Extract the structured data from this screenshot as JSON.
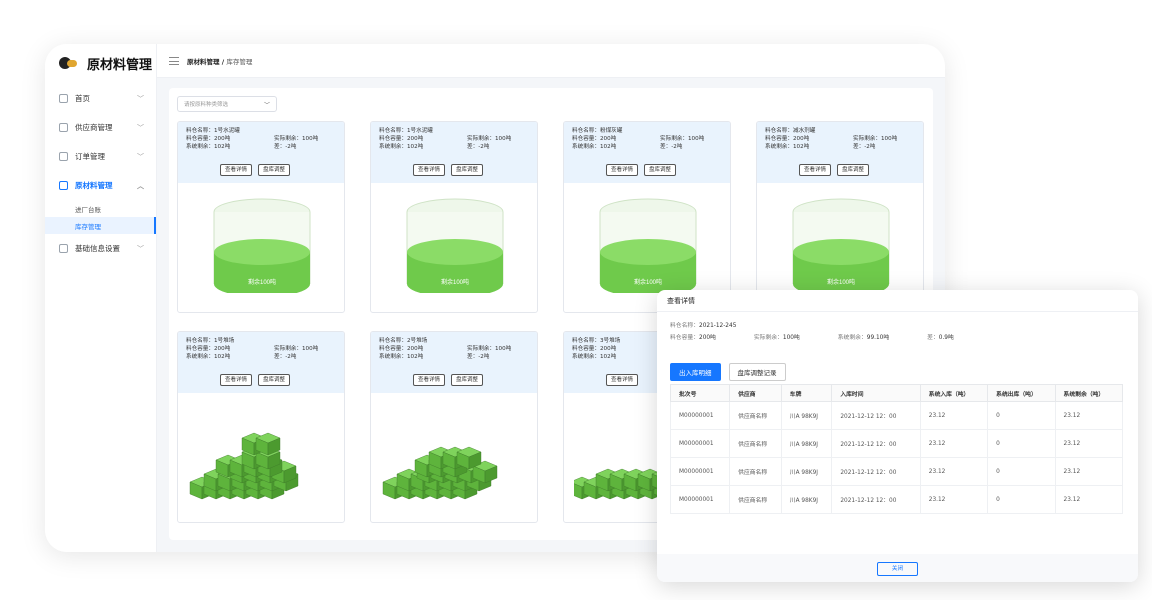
{
  "app": {
    "title": "原材料管理"
  },
  "breadcrumb": {
    "parent": "原材料管理",
    "separator": " / ",
    "current": "库存管理"
  },
  "sidebar": {
    "items": [
      {
        "label": "首页",
        "icon": "home-icon"
      },
      {
        "label": "供应商管理",
        "icon": "supplier-icon"
      },
      {
        "label": "订单管理",
        "icon": "order-icon"
      },
      {
        "label": "原材料管理",
        "icon": "material-icon",
        "active": true
      },
      {
        "label": "基础信息设置",
        "icon": "settings-icon"
      }
    ],
    "subitems": [
      {
        "label": "进厂台账"
      },
      {
        "label": "库存管理",
        "selected": true
      }
    ]
  },
  "filter": {
    "placeholder": "请按原料种类筛选"
  },
  "cards": [
    {
      "name": "料仓名称：1号水泥罐",
      "capacity": "料仓容量：200吨",
      "actual": "实际剩余：100吨",
      "system": "系统剩余：102吨",
      "diff": "差：-2吨",
      "view": "查看详情",
      "adjust": "盘库调整",
      "remain": "剩余100吨"
    },
    {
      "name": "料仓名称：1号水泥罐",
      "capacity": "料仓容量：200吨",
      "actual": "实际剩余：100吨",
      "system": "系统剩余：102吨",
      "diff": "差：-2吨",
      "view": "查看详情",
      "adjust": "盘库调整",
      "remain": "剩余100吨"
    },
    {
      "name": "料仓名称：粉煤灰罐",
      "capacity": "料仓容量：200吨",
      "actual": "实际剩余：100吨",
      "system": "系统剩余：102吨",
      "diff": "差：-2吨",
      "view": "查看详情",
      "adjust": "盘库调整",
      "remain": "剩余100吨"
    },
    {
      "name": "料仓名称：减水剂罐",
      "capacity": "料仓容量：200吨",
      "actual": "实际剩余：100吨",
      "system": "系统剩余：102吨",
      "diff": "差：-2吨",
      "view": "查看详情",
      "adjust": "盘库调整",
      "remain": "剩余100吨"
    },
    {
      "name": "料仓名称：1号堆场",
      "capacity": "料仓容量：200吨",
      "actual": "实际剩余：100吨",
      "system": "系统剩余：102吨",
      "diff": "差：-2吨",
      "view": "查看详情",
      "adjust": "盘库调整"
    },
    {
      "name": "料仓名称：2号堆场",
      "capacity": "料仓容量：200吨",
      "actual": "实际剩余：100吨",
      "system": "系统剩余：102吨",
      "diff": "差：-2吨",
      "view": "查看详情",
      "adjust": "盘库调整"
    },
    {
      "name": "料仓名称：3号堆场",
      "capacity": "料仓容量：200吨",
      "system": "系统剩余：102吨",
      "view": "查看详情"
    }
  ],
  "modal": {
    "title": "查看详情",
    "batch_label": "料仓名称：",
    "batch_value": "2021-12-245",
    "cap_label": "料仓容量：",
    "cap_value": "200吨",
    "actual_label": "实际剩余：",
    "actual_value": "100吨",
    "system_label": "系统剩余：",
    "system_value": "99.10吨",
    "diff_label": "差：",
    "diff_value": "0.9吨",
    "tab_in": "出入库明细",
    "tab_adjust": "盘库调整记录",
    "columns": [
      "批次号",
      "供应商",
      "车牌",
      "入库时间",
      "系统入库（吨）",
      "系统出库（吨）",
      "系统剩余（吨）"
    ],
    "rows": [
      [
        "M00000001",
        "供应商名称",
        "川A 98K9J",
        "2021-12-12 12：00",
        "23.12",
        "0",
        "23.12"
      ],
      [
        "M00000001",
        "供应商名称",
        "川A 98K9J",
        "2021-12-12 12：00",
        "23.12",
        "0",
        "23.12"
      ],
      [
        "M00000001",
        "供应商名称",
        "川A 98K9J",
        "2021-12-12 12：00",
        "23.12",
        "0",
        "23.12"
      ],
      [
        "M00000001",
        "供应商名称",
        "川A 98K9J",
        "2021-12-12 12：00",
        "23.12",
        "0",
        "23.12"
      ]
    ],
    "close_label": "关闭"
  },
  "colors": {
    "accent": "#1677ff",
    "fill_green": "#7dd45a",
    "card_head": "#e9f3fd"
  }
}
